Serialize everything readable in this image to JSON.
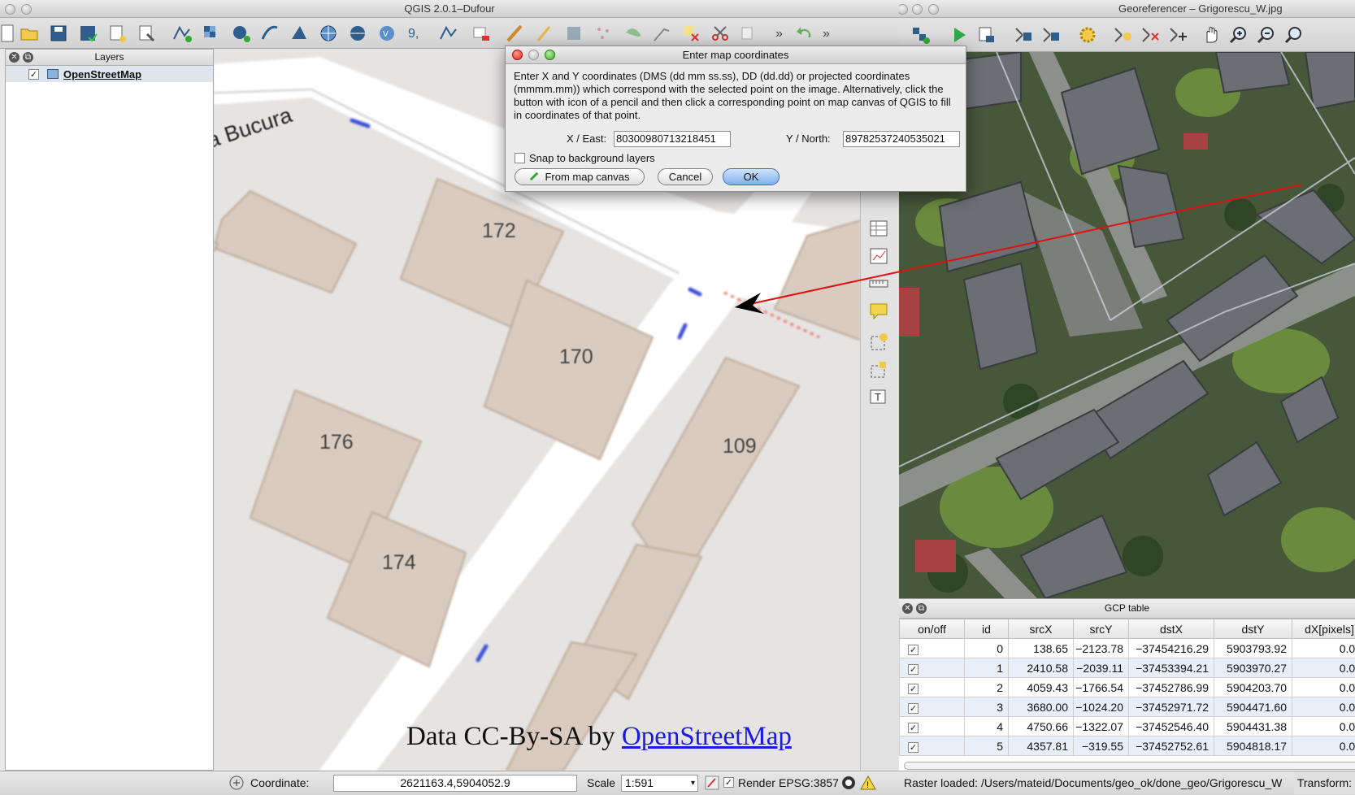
{
  "qgis": {
    "title": "QGIS 2.0.1–Dufour",
    "layers_panel": {
      "title": "Layers",
      "items": [
        {
          "name": "OpenStreetMap",
          "checked": true
        }
      ]
    },
    "map": {
      "street_label": "a Bucura",
      "buildings": [
        "172",
        "170",
        "176",
        "109",
        "174"
      ],
      "attribution_prefix": "Data CC-By-SA by ",
      "attribution_link": "OpenStreetMap"
    },
    "status": {
      "coordinate_label": "Coordinate:",
      "coordinate_value": "2621163.4,5904052.9",
      "scale_label": "Scale",
      "scale_value": "1:591",
      "render_label": "Render",
      "crs": "EPSG:3857"
    }
  },
  "georeferencer": {
    "title": "Georeferencer – Grigorescu_W.jpg",
    "gcp_table": {
      "title": "GCP table",
      "columns": [
        "on/off",
        "id",
        "srcX",
        "srcY",
        "dstX",
        "dstY",
        "dX[pixels]"
      ],
      "rows": [
        [
          "",
          "0",
          "138.65",
          "−2123.78",
          "−37454216.29",
          "5903793.92",
          "0.00"
        ],
        [
          "",
          "1",
          "2410.58",
          "−2039.11",
          "−37453394.21",
          "5903970.27",
          "0.00"
        ],
        [
          "",
          "2",
          "4059.43",
          "−1766.54",
          "−37452786.99",
          "5904203.70",
          "0.00"
        ],
        [
          "",
          "3",
          "3680.00",
          "−1024.20",
          "−37452971.72",
          "5904471.60",
          "0.00"
        ],
        [
          "",
          "4",
          "4750.66",
          "−1322.07",
          "−37452546.40",
          "5904431.38",
          "0.00"
        ],
        [
          "",
          "5",
          "4357.81",
          "−319.55",
          "−37452752.61",
          "5904818.17",
          "0.00"
        ]
      ]
    },
    "status": {
      "raster_loaded": "Raster loaded: /Users/mateid/Documents/geo_ok/done_geo/Grigorescu_W",
      "transform": "Transform:"
    }
  },
  "dialog": {
    "title": "Enter map coordinates",
    "message": "Enter X and Y coordinates (DMS (dd mm ss.ss), DD (dd.dd) or projected coordinates (mmmm.mm)) which correspond with the selected point on the image. Alternatively, click the button with icon of a pencil and then click a corresponding point on map canvas of QGIS to fill in coordinates of that point.",
    "x_label": "X / East:",
    "x_value": "8030098071321845​1",
    "y_label": "Y / North:",
    "y_value": "89782537240535021",
    "snap_label": "Snap to background layers",
    "snap_checked": false,
    "from_canvas_label": "From map canvas",
    "cancel_label": "Cancel",
    "ok_label": "OK"
  },
  "colors": {
    "ok_button": "#7fb0ea",
    "arrow": "#e01010",
    "link": "#1a1ae0",
    "building": "#d9cbbf"
  }
}
